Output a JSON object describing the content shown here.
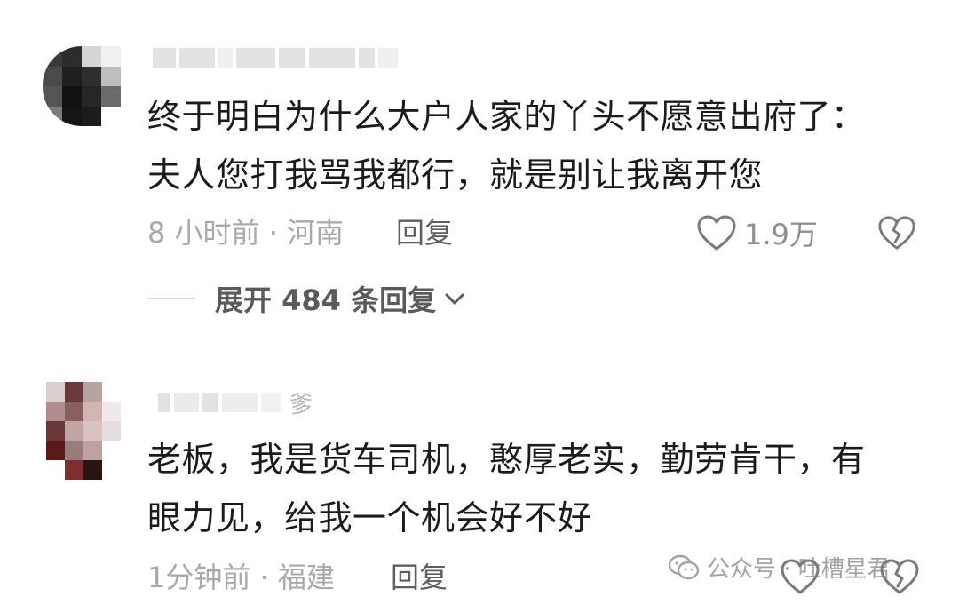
{
  "comments": [
    {
      "username": "",
      "text_line1": "终于明白为什么大户人家的丫头不愿意出府了：",
      "text_line2": "夫人您打我骂我都行，就是别让我离开您",
      "time_location": "8 小时前 · 河南",
      "reply_label": "回复",
      "likes": "1.9万",
      "expand_label": "展开 484 条回复"
    },
    {
      "username_visible": "爹",
      "text_line1": "老板，我是货车司机，憨厚老实，勤劳肯干，有",
      "text_line2": "眼力见，给我一个机会好不好",
      "time_location": "1分钟前 · 福建",
      "reply_label": "回复"
    }
  ],
  "watermark": {
    "label": "公众号 · 吐槽星君"
  },
  "colors": {
    "text": "#1b1b1b",
    "meta": "#a9a9a9",
    "reply": "#5e5e5e",
    "icon": "#7a7a7a"
  }
}
